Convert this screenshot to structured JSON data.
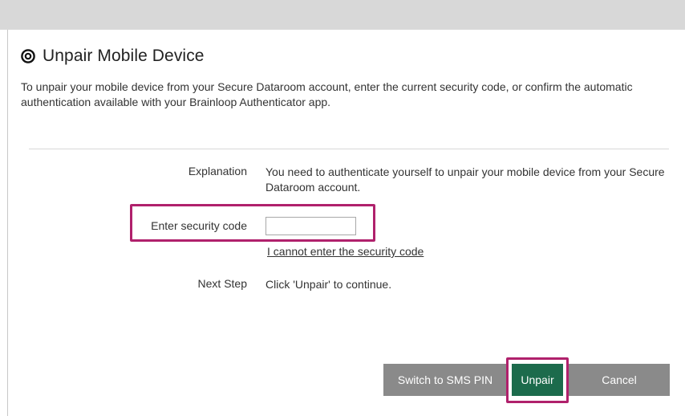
{
  "dialog": {
    "title": "Unpair Mobile Device",
    "intro": "To unpair your mobile device from your Secure Dataroom account, enter the current security code, or confirm the automatic authentication available with your Brainloop Authenticator app."
  },
  "form": {
    "explanation_label": "Explanation",
    "explanation_text": "You need to authenticate yourself to unpair your mobile device from your Secure Dataroom account.",
    "security_code_label": "Enter security code",
    "security_code_value": "",
    "security_code_placeholder": "",
    "cannot_enter_link": "I cannot enter the security code",
    "next_step_label": "Next Step",
    "next_step_text": "Click 'Unpair' to continue."
  },
  "buttons": {
    "switch_sms": "Switch to SMS PIN",
    "unpair": "Unpair",
    "cancel": "Cancel"
  },
  "colors": {
    "highlight": "#b0216c",
    "primary_button": "#1c6b4c",
    "secondary_button": "#8a8a8a"
  },
  "icons": {
    "title_icon": "target-icon"
  }
}
